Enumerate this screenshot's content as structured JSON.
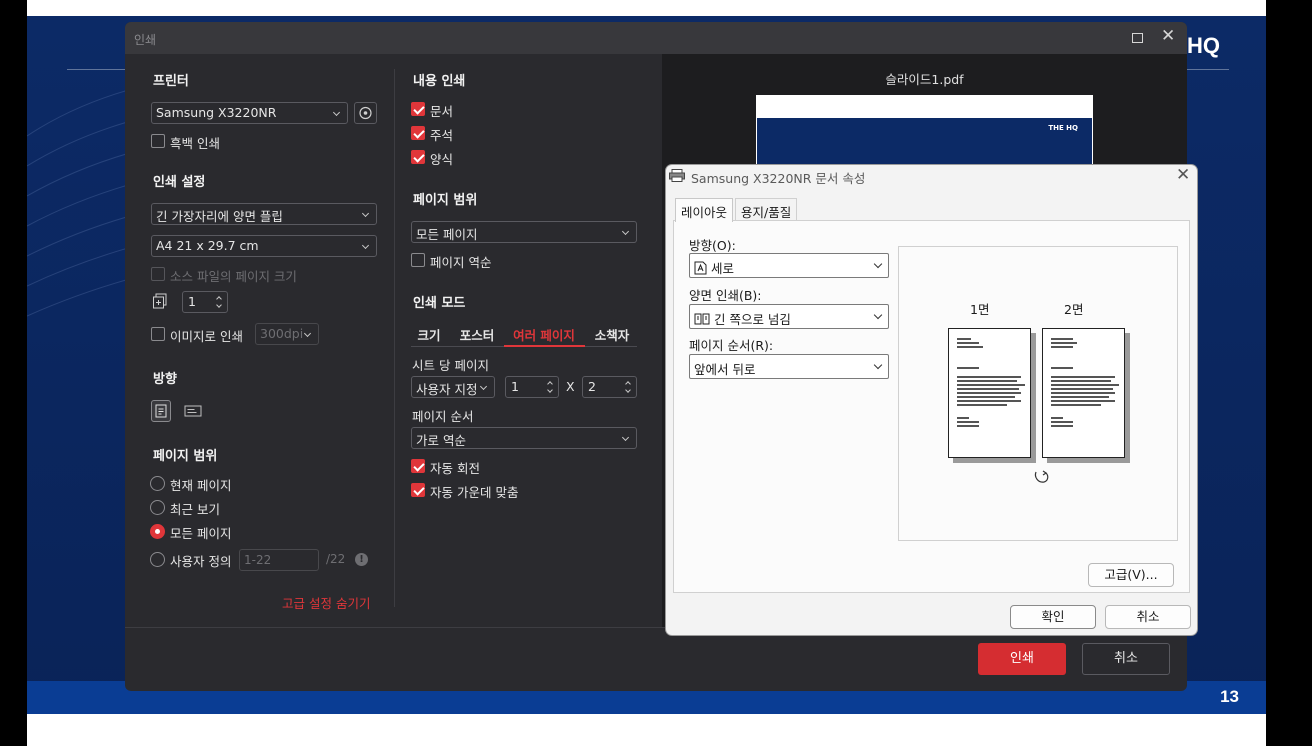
{
  "slide": {
    "logo": "HQ",
    "page_number": "13"
  },
  "print_dialog": {
    "title": "인쇄",
    "printer_section": "프린터",
    "printer_selected": "Samsung X3220NR",
    "grayscale_label": "흑백 인쇄",
    "settings_section": "인쇄 설정",
    "duplex_selected": "긴 가장자리에 양면 플립",
    "paper_selected": "A4 21 x 29.7 cm",
    "source_page_size_label": "소스 파일의 페이지 크기",
    "copies_value": "1",
    "print_as_image_label": "이미지로 인쇄",
    "dpi_selected": "300dpi",
    "orientation_section": "방향",
    "page_range_section": "페이지 범위",
    "range_current": "현재 페이지",
    "range_recent": "최근 보기",
    "range_all": "모든 페이지",
    "range_custom": "사용자 정의",
    "range_custom_placeholder": "1-22",
    "range_total": "/22",
    "hide_advanced": "고급 설정 숨기기",
    "content_section": "내용 인쇄",
    "content_document": "문서",
    "content_annotations": "주석",
    "content_forms": "양식",
    "page_range2_section": "페이지 범위",
    "page_range2_selected": "모든 페이지",
    "reverse_pages_label": "페이지 역순",
    "mode_section": "인쇄 모드",
    "mode_tabs": [
      "크기",
      "포스터",
      "여러 페이지",
      "소책자"
    ],
    "pages_per_sheet_label": "시트 당 페이지",
    "pages_per_sheet_selected": "사용자 지정",
    "cols_value": "1",
    "times": "X",
    "rows_value": "2",
    "page_order_label": "페이지 순서",
    "page_order_selected": "가로 역순",
    "auto_rotate": "자동 회전",
    "auto_center": "자동 가운데 맞춤",
    "preview_filename": "슬라이드1.pdf",
    "preview_logo": "THE HQ",
    "print_button": "인쇄",
    "cancel_button": "취소"
  },
  "properties_dialog": {
    "title": "Samsung X3220NR 문서 속성",
    "tabs": [
      "레이아웃",
      "용지/품질"
    ],
    "orientation_label": "방향(O):",
    "orientation_selected": "세로",
    "duplex_label": "양면 인쇄(B):",
    "duplex_selected": "긴 쪽으로 넘김",
    "page_order_label": "페이지 순서(R):",
    "page_order_selected": "앞에서 뒤로",
    "page1_label": "1면",
    "page2_label": "2면",
    "advanced_button": "고급(V)...",
    "ok_button": "확인",
    "cancel_button": "취소"
  },
  "colors": {
    "accent_red": "#e0363a",
    "slide_blue": "#0c2a66",
    "dark_panel": "#2a2a2e"
  }
}
